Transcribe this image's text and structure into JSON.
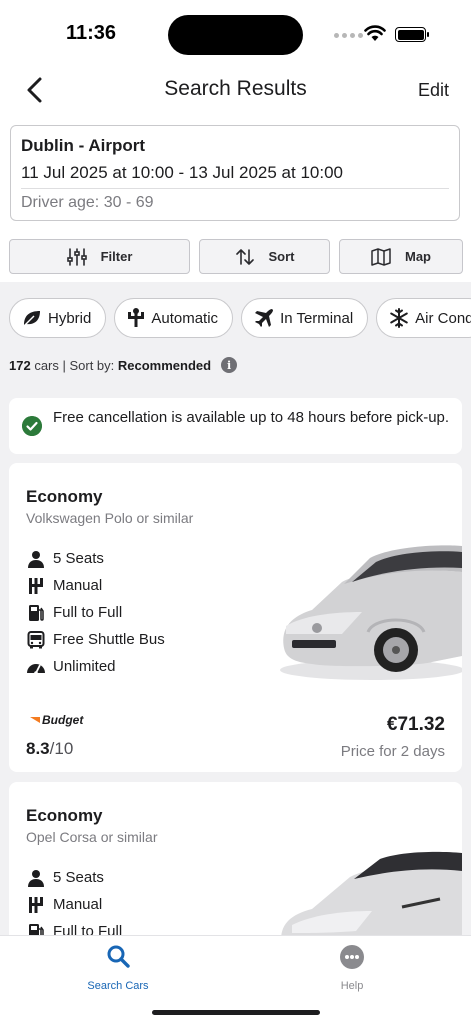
{
  "status": {
    "time": "11:36"
  },
  "nav": {
    "title": "Search Results",
    "edit": "Edit"
  },
  "search": {
    "location": "Dublin - Airport",
    "dates": "11 Jul 2025 at 10:00 - 13 Jul 2025 at 10:00",
    "driver_age": "Driver age: 30 - 69"
  },
  "tools": {
    "filter": "Filter",
    "sort": "Sort",
    "map": "Map"
  },
  "chips": [
    {
      "label": "Hybrid",
      "icon": "leaf-icon"
    },
    {
      "label": "Automatic",
      "icon": "gear-shift-icon"
    },
    {
      "label": "In Terminal",
      "icon": "airplane-icon"
    },
    {
      "label": "Air Cond",
      "icon": "snowflake-icon"
    }
  ],
  "results": {
    "count": "172",
    "count_suffix": " cars | Sort by: ",
    "sort_value": "Recommended"
  },
  "notice": "Free cancellation is available up to 48 hours before pick-up.",
  "cars": [
    {
      "class": "Economy",
      "model": "Volkswagen Polo or similar",
      "features": [
        "5 Seats",
        "Manual",
        "Full to Full",
        "Free Shuttle Bus",
        "Unlimited"
      ],
      "vendor": "Budget",
      "rating": "8.3",
      "rating_scale": "/10",
      "price": "€71.32",
      "price_note": "Price for 2 days"
    },
    {
      "class": "Economy",
      "model": "Opel Corsa or similar",
      "features": [
        "5 Seats",
        "Manual",
        "Full to Full"
      ]
    }
  ],
  "tabbar": {
    "search": "Search Cars",
    "help": "Help"
  },
  "colors": {
    "accent": "#1866b5",
    "success": "#2c7a3a",
    "budget": "#f47b20"
  }
}
